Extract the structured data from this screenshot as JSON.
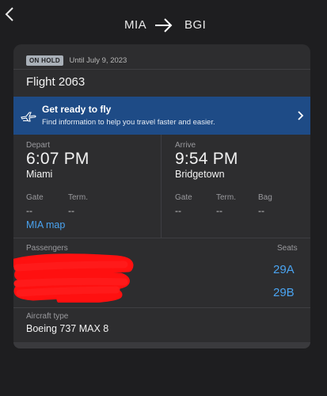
{
  "route": {
    "origin": "MIA",
    "destination": "BGI"
  },
  "reservation": {
    "status_badge": "ON HOLD",
    "hold_until": "Until July 9, 2023"
  },
  "flight": {
    "title": "Flight 2063"
  },
  "banner": {
    "title": "Get ready to fly",
    "subtitle": "Find information to help you travel faster and easier."
  },
  "depart": {
    "label": "Depart",
    "time": "6:07 PM",
    "city": "Miami",
    "gate_label": "Gate",
    "gate_value": "--",
    "term_label": "Term.",
    "term_value": "--",
    "map_link": "MIA map"
  },
  "arrive": {
    "label": "Arrive",
    "time": "9:54 PM",
    "city": "Bridgetown",
    "gate_label": "Gate",
    "gate_value": "--",
    "term_label": "Term.",
    "term_value": "--",
    "bag_label": "Bag",
    "bag_value": "--"
  },
  "passengers": {
    "label": "Passengers",
    "seats_label": "Seats",
    "seats": [
      "29A",
      "29B"
    ]
  },
  "aircraft": {
    "label": "Aircraft type",
    "value": "Boeing 737 MAX 8"
  },
  "colors": {
    "background": "#1e1e20",
    "card": "#2d2d2f",
    "banner": "#1e4b86",
    "link": "#4aa3f0",
    "redaction": "#ff1010"
  },
  "icons": {
    "back": "chevron-left-icon",
    "route_arrow": "arrow-right-icon",
    "banner": "airplane-icon",
    "banner_chevron": "chevron-right-icon"
  }
}
